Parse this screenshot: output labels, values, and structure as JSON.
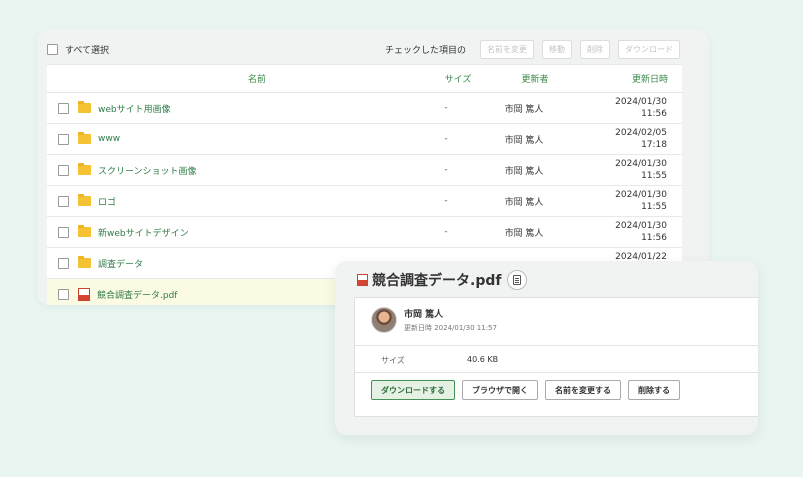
{
  "toolbar": {
    "select_all": "すべて選択",
    "checked_items": "チェックした項目の",
    "buttons": [
      "名前を変更",
      "移動",
      "削除",
      "ダウンロード"
    ]
  },
  "table": {
    "headers": {
      "name": "名前",
      "size": "サイズ",
      "updater": "更新者",
      "updated": "更新日時"
    },
    "rows": [
      {
        "name": "webサイト用画像",
        "type": "folder",
        "size": "-",
        "updater": "市岡 篤人",
        "date": "2024/01/30",
        "time": "11:56"
      },
      {
        "name": "www",
        "type": "folder",
        "size": "-",
        "updater": "市岡 篤人",
        "date": "2024/02/05",
        "time": "17:18"
      },
      {
        "name": "スクリーンショット画像",
        "type": "folder",
        "size": "-",
        "updater": "市岡 篤人",
        "date": "2024/01/30",
        "time": "11:55"
      },
      {
        "name": "ロゴ",
        "type": "folder",
        "size": "-",
        "updater": "市岡 篤人",
        "date": "2024/01/30",
        "time": "11:55"
      },
      {
        "name": "新webサイトデザイン",
        "type": "folder",
        "size": "-",
        "updater": "市岡 篤人",
        "date": "2024/01/30",
        "time": "11:56"
      },
      {
        "name": "調査データ",
        "type": "folder",
        "size": "",
        "updater": "",
        "date": "2024/01/22",
        "time": ""
      },
      {
        "name": "競合調査データ.pdf",
        "type": "pdf",
        "size": "",
        "updater": "",
        "date": "",
        "time": ""
      }
    ]
  },
  "detail": {
    "title": "競合調査データ.pdf",
    "owner_name": "市岡 篤人",
    "updated": "更新日時  2024/01/30 11:57",
    "size_label": "サイズ",
    "size_value": "40.6 KB",
    "actions": [
      "ダウンロードする",
      "ブラウザで開く",
      "名前を変更する",
      "削除する"
    ]
  },
  "icons": {
    "folder": "folder-icon",
    "pdf": "pdf-file-icon",
    "memo": "clipboard-icon"
  },
  "colors": {
    "background": "#e9f5f1",
    "link_green": "#2f7c46",
    "folder_yellow": "#f5c233",
    "pdf_red": "#d64532",
    "highlight_row": "#fbfbe3"
  }
}
